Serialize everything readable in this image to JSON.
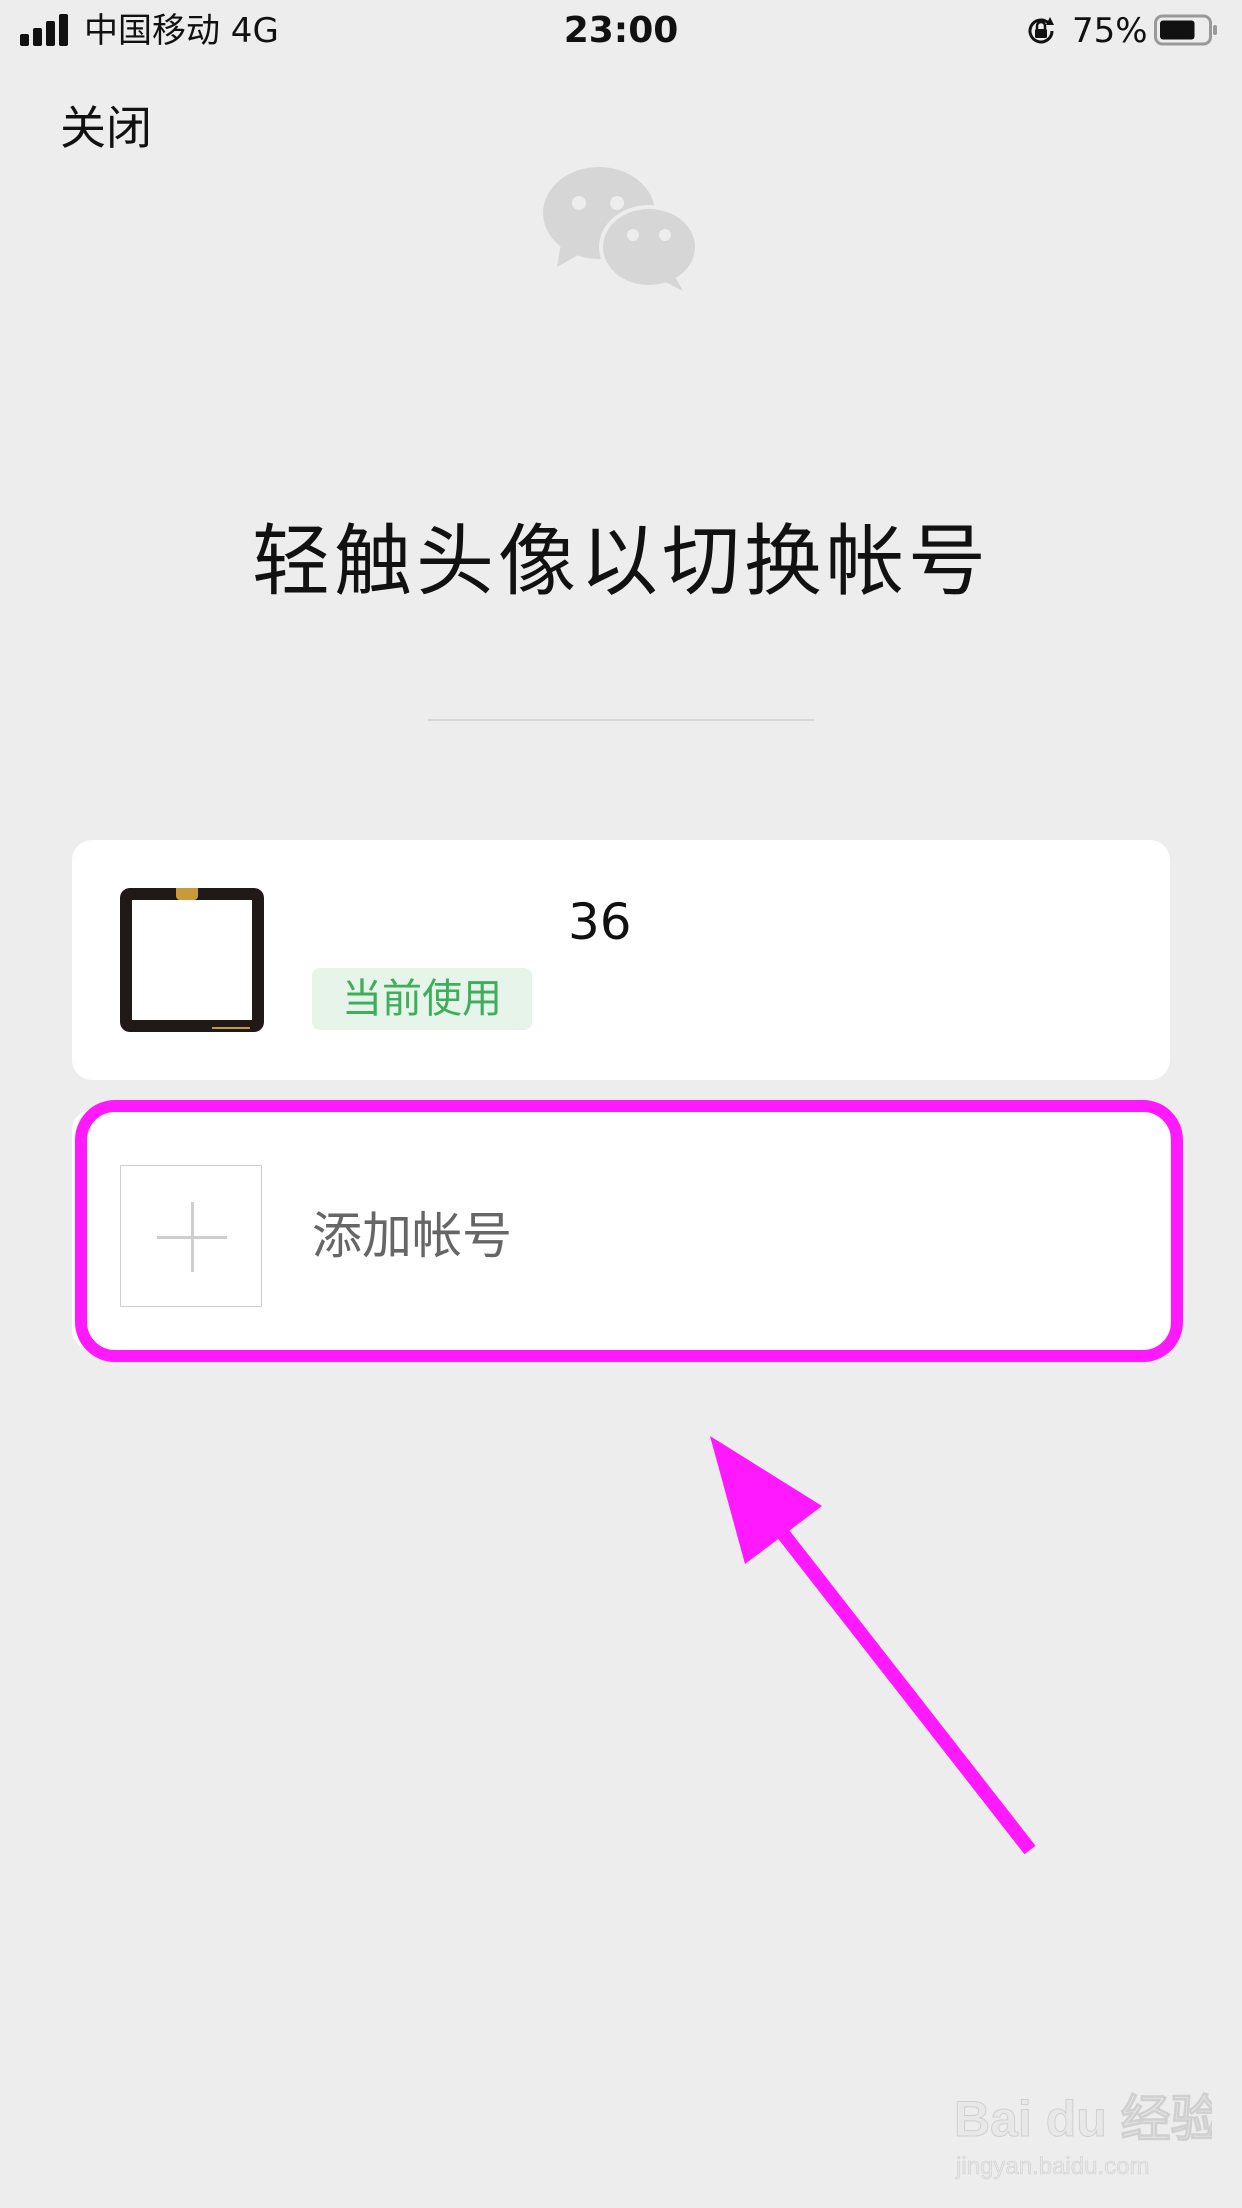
{
  "status_bar": {
    "carrier": "中国移动  4G",
    "time": "23:00",
    "battery_percent": "75%",
    "battery_level": 0.75
  },
  "close_label": "关闭",
  "heading": "轻触头像以切换帐号",
  "current_account": {
    "name": "36",
    "badge": "当前使用"
  },
  "add_account_label": "添加帐号",
  "watermark": {
    "brand": "Bai du 经验",
    "url": "jingyan.baidu.com"
  },
  "colors": {
    "background": "#ededed",
    "card": "#ffffff",
    "badge_bg": "#e6f4ea",
    "badge_text": "#3fae5c",
    "annotation": "#ff19ff"
  },
  "icons": [
    "signal-icon",
    "rotation-lock-icon",
    "battery-icon",
    "wechat-logo-icon",
    "plus-icon",
    "annotation-arrow"
  ]
}
